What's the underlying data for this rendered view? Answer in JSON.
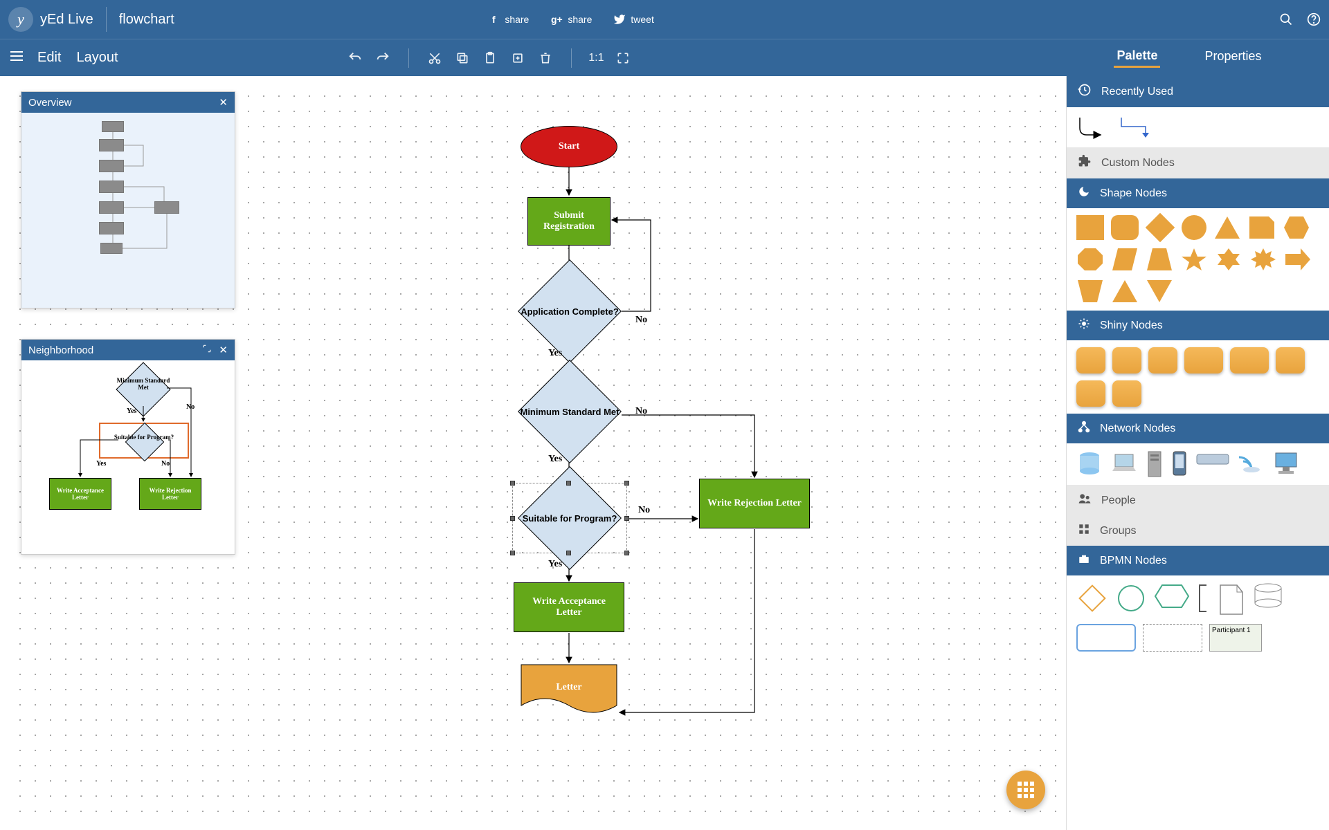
{
  "header": {
    "app_name": "yEd Live",
    "file_name": "flowchart",
    "share_fb": "share",
    "share_gp": "share",
    "share_tw": "tweet"
  },
  "menu": {
    "edit": "Edit",
    "layout": "Layout",
    "fit": "1:1"
  },
  "tabs": {
    "palette": "Palette",
    "properties": "Properties"
  },
  "panels": {
    "overview": "Overview",
    "neighborhood": "Neighborhood"
  },
  "palette": {
    "recently_used": "Recently Used",
    "custom_nodes": "Custom Nodes",
    "shape_nodes": "Shape Nodes",
    "shiny_nodes": "Shiny Nodes",
    "network_nodes": "Network Nodes",
    "people": "People",
    "groups": "Groups",
    "bpmn_nodes": "BPMN Nodes",
    "participant": "Participant 1"
  },
  "flowchart": {
    "start": "Start",
    "submit": "Submit Registration",
    "complete": "Application Complete?",
    "minstd": "Minimum Standard Met",
    "suitable": "Suitable for Program?",
    "accept": "Write Acceptance Letter",
    "reject": "Write Rejection Letter",
    "letter": "Letter",
    "yes": "Yes",
    "no": "No"
  },
  "neighborhood": {
    "minstd": "Minimum Standard Met",
    "suitable": "Suitable for Program?",
    "accept": "Write Acceptance Letter",
    "reject": "Write Rejection Letter",
    "yes": "Yes",
    "no": "No"
  },
  "chart_data": {
    "type": "flowchart",
    "nodes": [
      {
        "id": "start",
        "type": "terminator",
        "label": "Start",
        "fill": "#d01818"
      },
      {
        "id": "submit",
        "type": "process",
        "label": "Submit Registration",
        "fill": "#64a819"
      },
      {
        "id": "complete",
        "type": "decision",
        "label": "Application Complete?",
        "fill": "#d2e1f0"
      },
      {
        "id": "minstd",
        "type": "decision",
        "label": "Minimum Standard Met",
        "fill": "#d2e1f0"
      },
      {
        "id": "suitable",
        "type": "decision",
        "label": "Suitable for Program?",
        "fill": "#d2e1f0",
        "selected": true
      },
      {
        "id": "accept",
        "type": "process",
        "label": "Write Acceptance Letter",
        "fill": "#64a819"
      },
      {
        "id": "reject",
        "type": "process",
        "label": "Write Rejection Letter",
        "fill": "#64a819"
      },
      {
        "id": "letter",
        "type": "document",
        "label": "Letter",
        "fill": "#e8a33d"
      }
    ],
    "edges": [
      {
        "from": "start",
        "to": "submit"
      },
      {
        "from": "submit",
        "to": "complete"
      },
      {
        "from": "complete",
        "to": "minstd",
        "label": "Yes"
      },
      {
        "from": "complete",
        "to": "submit",
        "label": "No",
        "loopback": true
      },
      {
        "from": "minstd",
        "to": "suitable",
        "label": "Yes"
      },
      {
        "from": "minstd",
        "to": "reject",
        "label": "No"
      },
      {
        "from": "suitable",
        "to": "accept",
        "label": "Yes"
      },
      {
        "from": "suitable",
        "to": "reject",
        "label": "No"
      },
      {
        "from": "accept",
        "to": "letter"
      },
      {
        "from": "reject",
        "to": "letter"
      }
    ]
  }
}
